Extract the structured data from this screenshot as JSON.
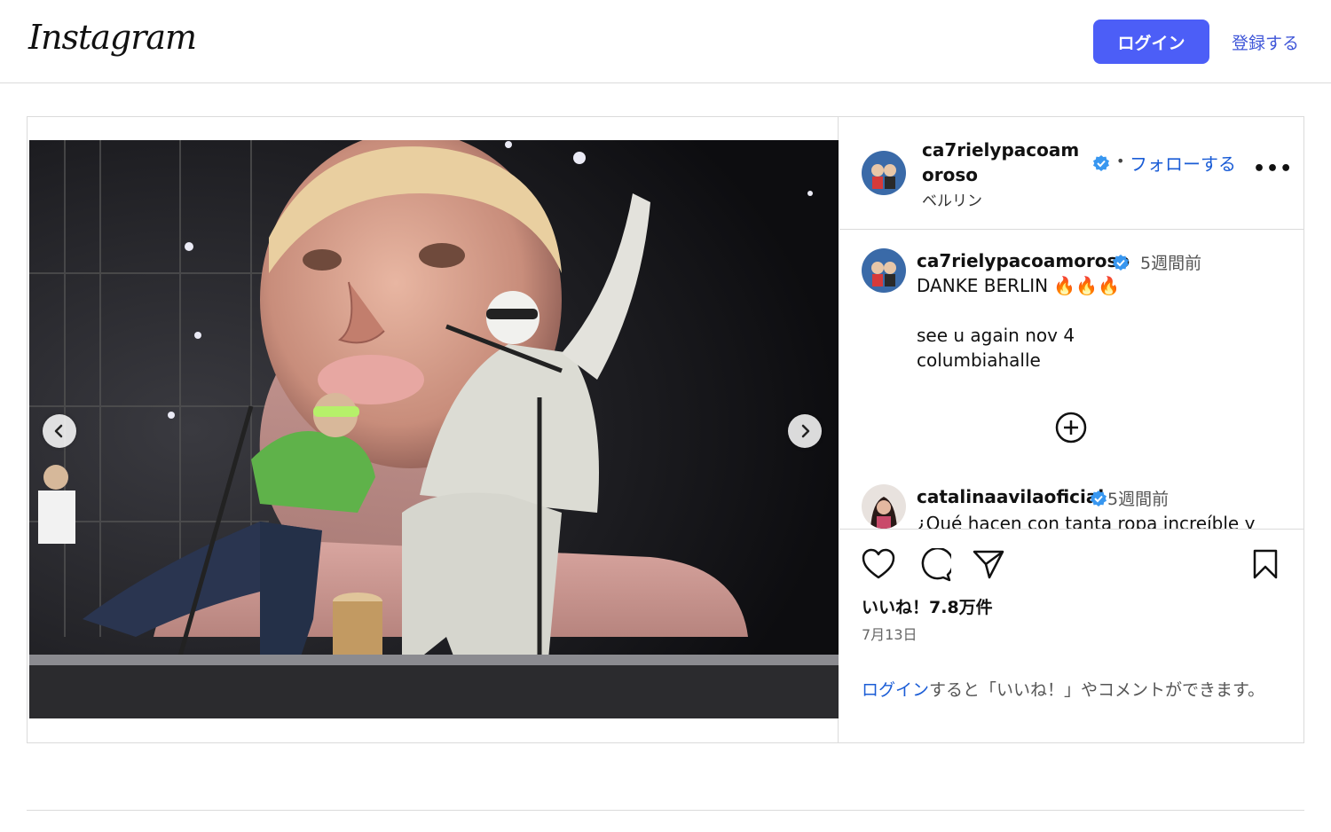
{
  "nav": {
    "logo_text": "Instagram",
    "login_label": "ログイン",
    "signup_label": "登録する"
  },
  "post": {
    "author": {
      "username": "ca7rielypacoamoroso",
      "location": "ベルリン",
      "follow_label": "フォローする",
      "verified": true
    },
    "caption": {
      "username": "ca7rielypacoamoroso",
      "time": "5週間前",
      "text": "DANKE BERLIN 🔥🔥🔥\n\nsee u again nov 4\ncolumbiahalle"
    },
    "comments": [
      {
        "username": "catalinaavilaoficial",
        "time": "5週間前",
        "text": "¿Qué hacen con tanta ropa increíble y"
      }
    ],
    "likes": "いいね！7.8万件",
    "date": "7月13日",
    "cta_link": "ログイン",
    "cta_text": "すると「いいね！」やコメントができます。"
  },
  "colors": {
    "accent": "#4c5ef7",
    "link": "#1a5cd6",
    "verified": "#3897f0"
  },
  "icons": [
    "chevron-left-icon",
    "chevron-right-icon",
    "verified-badge-icon",
    "more-icon",
    "add-circle-icon",
    "heart-icon",
    "comment-icon",
    "share-icon",
    "bookmark-icon"
  ]
}
